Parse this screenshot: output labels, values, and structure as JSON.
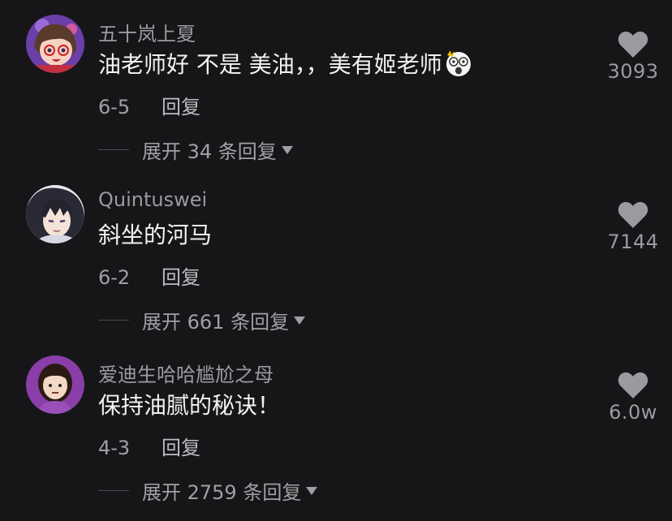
{
  "comments": [
    {
      "username": "五十岚上夏",
      "text": "油老师好 不是 美油，，美有姬老师",
      "emoji": "shocked-face-emoji",
      "date": "6-5",
      "reply_label": "回复",
      "expand_text": "展开 34 条回复",
      "likes": "3093",
      "avatar": "anime-girl-glasses-avatar"
    },
    {
      "username": "Quintuswei",
      "text": "斜坐的河马",
      "date": "6-2",
      "reply_label": "回复",
      "expand_text": "展开 661 条回复",
      "likes": "7144",
      "avatar": "anime-boy-dark-hair-avatar"
    },
    {
      "username": "爱迪生哈哈尴尬之母",
      "text": "保持油腻的秘诀！",
      "date": "4-3",
      "reply_label": "回复",
      "expand_text": "展开 2759 条回复",
      "likes": "6.0w",
      "avatar": "woman-emoji-avatar"
    }
  ],
  "colors": {
    "background": "#161618",
    "username": "#9b9b9f",
    "text": "#f2f2f2",
    "secondary": "#a0a0a4",
    "heart": "#9b9b9f"
  }
}
